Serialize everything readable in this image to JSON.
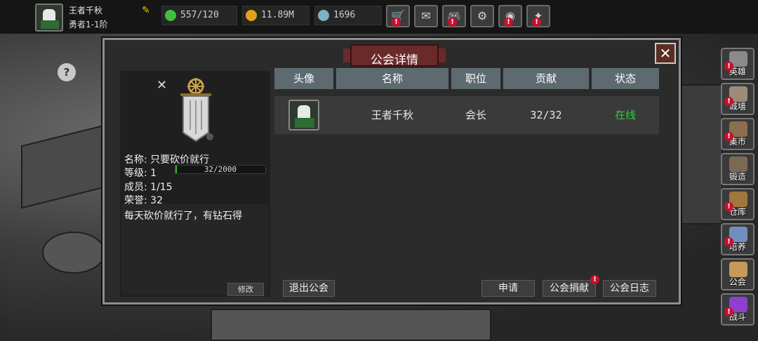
{
  "player": {
    "name": "王者千秋",
    "rank": "勇者1-1阶"
  },
  "resources": [
    {
      "icon": "energy-icon",
      "value": "557/120",
      "color": "#3fbf3f"
    },
    {
      "icon": "gold-coin-icon",
      "value": "11.89M",
      "color": "#e0a21a"
    },
    {
      "icon": "diamond-icon",
      "value": "1696",
      "color": "#7fb0c8"
    }
  ],
  "toolbar": [
    {
      "name": "shop-cart-icon",
      "glyph": "🛒",
      "badge": true
    },
    {
      "name": "mail-icon",
      "glyph": "✉",
      "badge": false
    },
    {
      "name": "gamepad-icon",
      "glyph": "🎮",
      "badge": true
    },
    {
      "name": "settings-gear-icon",
      "glyph": "⚙",
      "badge": false
    },
    {
      "name": "lucky-wheel-icon",
      "glyph": "◉",
      "badge": true
    },
    {
      "name": "broom-icon",
      "glyph": "✦",
      "badge": true
    }
  ],
  "sidebar": [
    {
      "label": "英雄",
      "color": "#8a8a8a",
      "badge": true
    },
    {
      "label": "城墙",
      "color": "#9c8b78",
      "badge": true
    },
    {
      "label": "集市",
      "color": "#8b6f4e",
      "badge": true
    },
    {
      "label": "锻造",
      "color": "#7a6a55",
      "badge": false
    },
    {
      "label": "仓库",
      "color": "#a0783c",
      "badge": true
    },
    {
      "label": "培养",
      "color": "#6f8fbf",
      "badge": true
    },
    {
      "label": "公会",
      "color": "#c79a5a",
      "badge": false
    },
    {
      "label": "战斗",
      "color": "#8e3fd0",
      "badge": true
    }
  ],
  "dialog": {
    "title": "公会详情",
    "close_symbol": "✕",
    "guild": {
      "name_label": "名称:",
      "name": "只要砍价就行",
      "level_label": "等级:",
      "level": "1",
      "exp": "32/2000",
      "exp_fraction": 0.016,
      "members_label": "成员:",
      "members": "1/15",
      "honor_label": "荣誉:",
      "honor": "32",
      "notice": "每天砍价就行了，有钻石得",
      "modify_label": "修改"
    },
    "table": {
      "headers": [
        "头像",
        "名称",
        "职位",
        "贡献",
        "状态"
      ],
      "rows": [
        {
          "name": "王者千秋",
          "position": "会长",
          "contribution": "32/32",
          "status": "在线",
          "status_color": "#2ecc40"
        }
      ]
    },
    "buttons": {
      "leave": "退出公会",
      "apply": "申请",
      "donate": "公会捐献",
      "log": "公会日志"
    }
  }
}
